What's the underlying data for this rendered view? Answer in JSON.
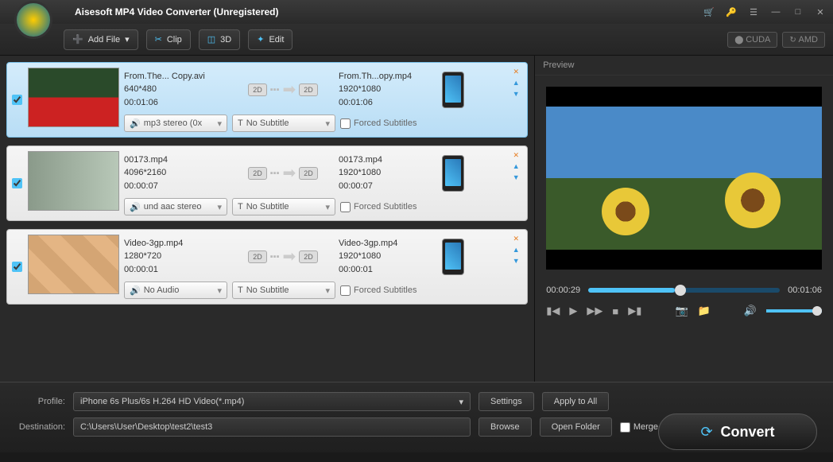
{
  "title": "Aisesoft MP4 Video Converter (Unregistered)",
  "toolbar": {
    "add_file": "Add File",
    "clip": "Clip",
    "three_d": "3D",
    "edit": "Edit",
    "cuda": "CUDA",
    "amd": "AMD"
  },
  "files": [
    {
      "selected": true,
      "thumb": "tulips",
      "src_name": "From.The... Copy.avi",
      "src_res": "640*480",
      "src_dur": "00:01:06",
      "dst_name": "From.Th...opy.mp4",
      "dst_res": "1920*1080",
      "dst_dur": "00:01:06",
      "audio": "mp3 stereo (0x",
      "subtitle": "No Subtitle",
      "forced": "Forced Subtitles"
    },
    {
      "selected": false,
      "thumb": "person",
      "src_name": "00173.mp4",
      "src_res": "4096*2160",
      "src_dur": "00:00:07",
      "dst_name": "00173.mp4",
      "dst_res": "1920*1080",
      "dst_dur": "00:00:07",
      "audio": "und aac stereo",
      "subtitle": "No Subtitle",
      "forced": "Forced Subtitles"
    },
    {
      "selected": false,
      "thumb": "grid4",
      "src_name": "Video-3gp.mp4",
      "src_res": "1280*720",
      "src_dur": "00:00:01",
      "dst_name": "Video-3gp.mp4",
      "dst_res": "1920*1080",
      "dst_dur": "00:00:01",
      "audio": "No Audio",
      "subtitle": "No Subtitle",
      "forced": "Forced Subtitles"
    }
  ],
  "preview": {
    "label": "Preview",
    "time_cur": "00:00:29",
    "time_total": "00:01:06"
  },
  "bottom": {
    "profile_label": "Profile:",
    "profile_value": "iPhone 6s Plus/6s H.264 HD Video(*.mp4)",
    "dest_label": "Destination:",
    "dest_value": "C:\\Users\\User\\Desktop\\test2\\test3",
    "settings": "Settings",
    "apply_all": "Apply to All",
    "browse": "Browse",
    "open_folder": "Open Folder",
    "merge": "Merge into one file",
    "convert": "Convert"
  },
  "badge2d": "2D"
}
